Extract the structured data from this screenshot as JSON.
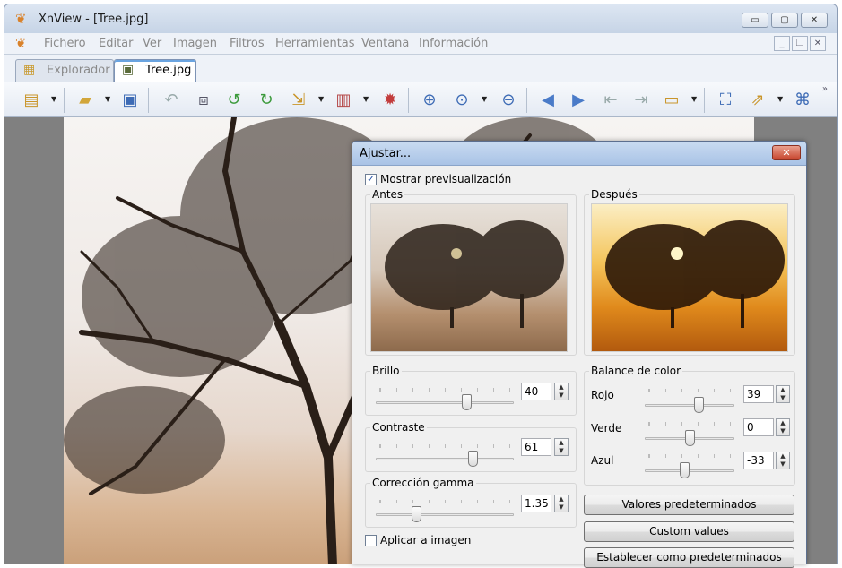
{
  "window": {
    "title": "XnView - [Tree.jpg]"
  },
  "menu": [
    "Fichero",
    "Editar",
    "Ver",
    "Imagen",
    "Filtros",
    "Herramientas",
    "Ventana",
    "Información"
  ],
  "tabs": [
    {
      "label": "Explorador",
      "active": false
    },
    {
      "label": "Tree.jpg",
      "active": true
    }
  ],
  "dialog": {
    "title": "Ajustar...",
    "show_preview": {
      "label": "Mostrar previsualización",
      "checked": true
    },
    "before_label": "Antes",
    "after_label": "Después",
    "brightness": {
      "label": "Brillo",
      "value": "40",
      "level": 0.67
    },
    "contrast": {
      "label": "Contraste",
      "value": "61",
      "level": 0.72
    },
    "gamma": {
      "label": "Corrección gamma",
      "value": "1.35",
      "level": 0.28
    },
    "color_balance": {
      "label": "Balance de color",
      "red": {
        "label": "Rojo",
        "value": "39",
        "level": 0.62
      },
      "green": {
        "label": "Verde",
        "value": "0",
        "level": 0.5
      },
      "blue": {
        "label": "Azul",
        "value": "-33",
        "level": 0.44
      }
    },
    "apply_to_image": {
      "label": "Aplicar a imagen",
      "checked": false
    },
    "buttons": {
      "defaults": "Valores predeterminados",
      "custom": "Custom values",
      "set_default": "Establecer como predeterminados"
    }
  },
  "colors": {
    "accent": "#6aa4e0",
    "titlebar": "#c6d4e6",
    "dialog_close": "#c7442d"
  }
}
